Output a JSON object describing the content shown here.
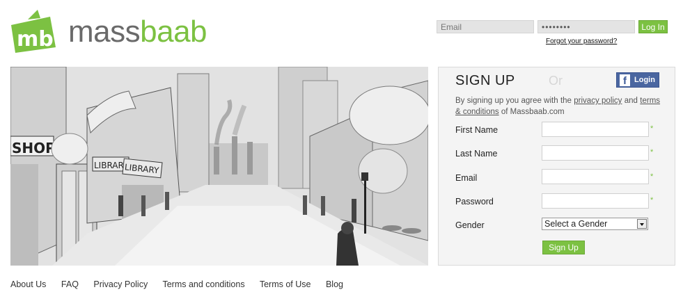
{
  "logo": {
    "badge_text": "mb",
    "name_part1": "mass",
    "name_part2": "baab"
  },
  "top_login": {
    "email_placeholder": "Email",
    "password_value": "••••••••",
    "login_label": "Log In",
    "forgot_label": "Forgot your password?"
  },
  "hero": {
    "shop_sign": "SHOP",
    "library_sign_1": "LIBRARY",
    "library_sign_2": "LIBRARY"
  },
  "signup": {
    "title": "SIGN UP",
    "or": "Or",
    "fb_login": "Login",
    "terms": {
      "prefix": "By signing up you agree with the",
      "privacy_link": "privacy policy",
      "and": "and",
      "terms_link": "terms & conditions",
      "suffix": "of Massbaab.com"
    },
    "fields": {
      "first_name": "First Name",
      "last_name": "Last Name",
      "email": "Email",
      "password": "Password",
      "gender": "Gender"
    },
    "required_mark": "*",
    "gender_selected": "Select a Gender",
    "submit_label": "Sign Up"
  },
  "footer": {
    "links": [
      "About Us",
      "FAQ",
      "Privacy Policy",
      "Terms and conditions",
      "Terms of Use",
      "Blog"
    ]
  },
  "colors": {
    "brand_green": "#7cc142",
    "brand_grey": "#6a6a6a",
    "facebook_blue": "#4a66a0"
  }
}
